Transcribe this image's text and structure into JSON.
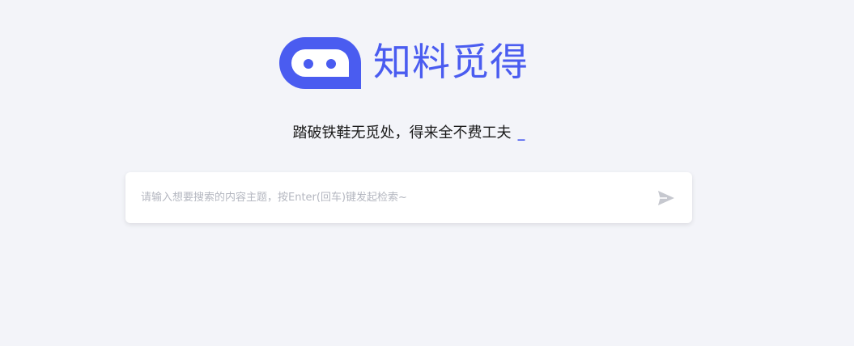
{
  "brand": {
    "name": "知料觅得",
    "color": "#4a5cf0"
  },
  "slogan": {
    "text": "踏破铁鞋无觅处，得来全不费工夫",
    "cursor": "_"
  },
  "search": {
    "placeholder": "请输入想要搜索的内容主题，按Enter(回车)键发起检索~",
    "value": "",
    "send_icon": "send-icon"
  }
}
